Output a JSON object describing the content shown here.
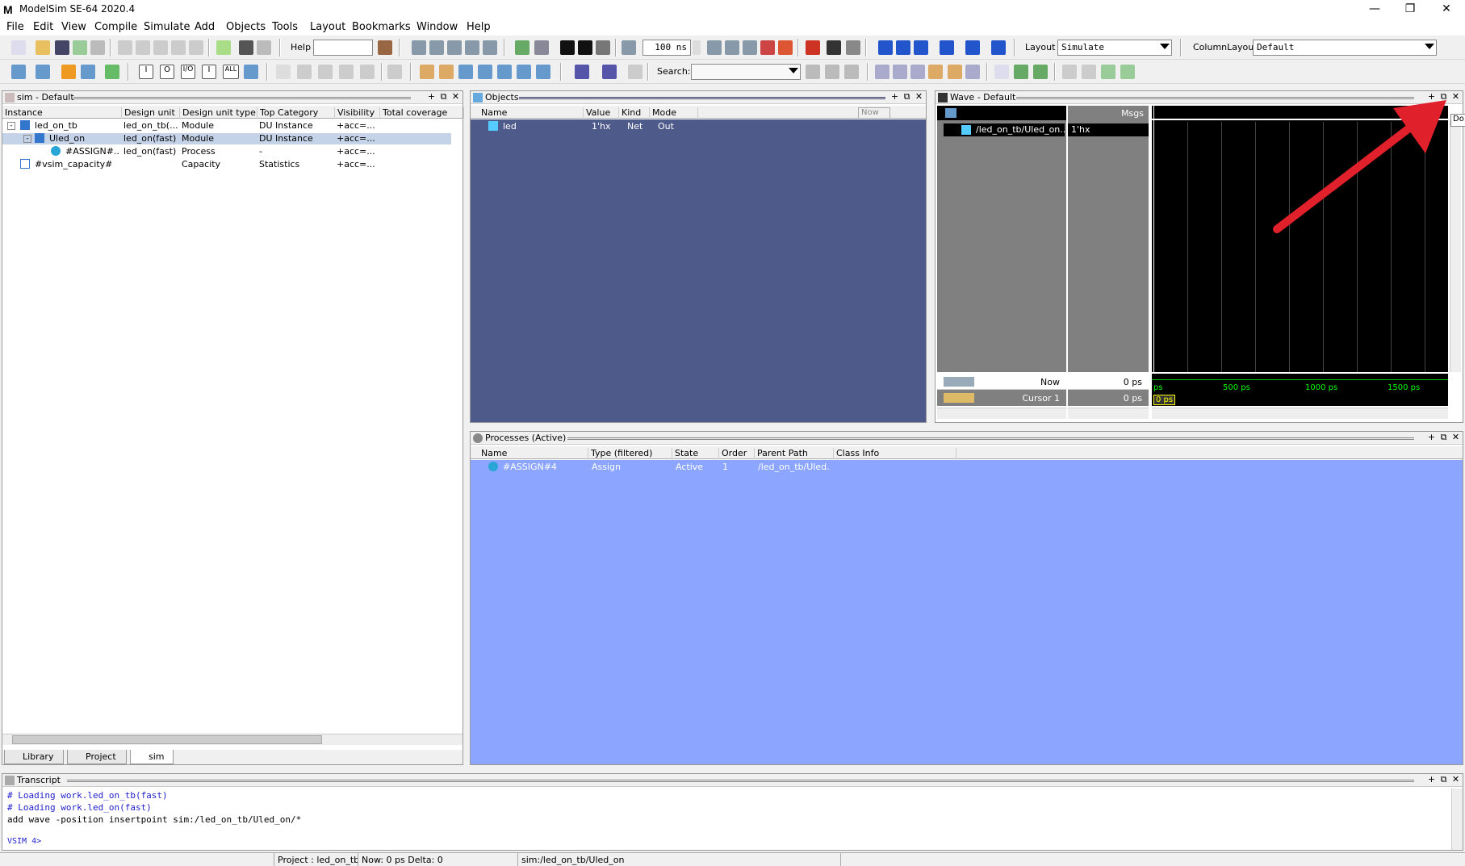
{
  "window": {
    "title": "ModelSim SE-64 2020.4",
    "logo": "M",
    "buttons": [
      "—",
      "❐",
      "✕"
    ]
  },
  "menu": [
    "File",
    "Edit",
    "View",
    "Compile",
    "Simulate",
    "Add",
    "Objects",
    "Tools",
    "Layout",
    "Bookmarks",
    "Window",
    "Help"
  ],
  "toolbar": {
    "help_label": "Help",
    "help_value": "",
    "runtime_value": "100 ns",
    "layout_label": "Layout",
    "layout_value": "Simulate",
    "column_layout_label": "ColumnLayout",
    "column_layout_value": "Default",
    "search_label": "Search:",
    "search_value": "",
    "filter_buttons": [
      "I",
      "O",
      "I/O",
      "I",
      "ALL"
    ]
  },
  "sim_panel": {
    "title": "sim - Default",
    "columns": [
      "Instance",
      "Design unit",
      "Design unit type",
      "Top Category",
      "Visibility",
      "Total coverage"
    ],
    "rows": [
      {
        "expander": "-",
        "instance": "led_on_tb",
        "unit": "led_on_tb(...",
        "type": "Module",
        "category": "DU Instance",
        "visibility": "+acc=..."
      },
      {
        "expander": "-",
        "instance": "Uled_on",
        "unit": "led_on(fast)",
        "type": "Module",
        "category": "DU Instance",
        "visibility": "+acc=..."
      },
      {
        "expander": "",
        "instance": "#ASSIGN#...",
        "unit": "led_on(fast)",
        "type": "Process",
        "category": "-",
        "visibility": "+acc=..."
      },
      {
        "expander": "",
        "instance": "#vsim_capacity#",
        "unit": "",
        "type": "Capacity",
        "category": "Statistics",
        "visibility": "+acc=..."
      }
    ],
    "tabs": [
      "Library",
      "Project",
      "sim"
    ]
  },
  "objects_panel": {
    "title": "Objects",
    "columns": [
      "Name",
      "Value",
      "Kind",
      "Mode"
    ],
    "now_label": "Now",
    "rows": [
      {
        "name": "led",
        "value": "1'hx",
        "kind": "Net",
        "mode": "Out"
      }
    ]
  },
  "wave_panel": {
    "title": "Wave - Default",
    "msgs_label": "Msgs",
    "signal_name": "/led_on_tb/Uled_on...",
    "signal_value": "1'hx",
    "now_label": "Now",
    "now_value": "0 ps",
    "cursor_label": "Cursor 1",
    "cursor_value": "0 ps",
    "cursor_marker": "0 ps",
    "ticks": [
      "ps",
      "500 ps",
      "1000 ps",
      "1500 ps"
    ],
    "tooltip": "Do"
  },
  "processes_panel": {
    "title": "Processes (Active)",
    "columns": [
      "Name",
      "Type (filtered)",
      "State",
      "Order",
      "Parent Path",
      "Class Info"
    ],
    "rows": [
      {
        "name": "#ASSIGN#4",
        "type": "Assign",
        "state": "Active",
        "order": "1",
        "parent": "/led_on_tb/Uled..."
      }
    ]
  },
  "transcript": {
    "title": "Transcript",
    "lines": [
      "# Loading work.led_on_tb(fast)",
      "# Loading work.led_on(fast)",
      "add wave -position insertpoint sim:/led_on_tb/Uled_on/*"
    ],
    "prompt": "VSIM 4>"
  },
  "statusbar": {
    "project": "Project : led_on_tb",
    "now": "Now: 0 ps  Delta: 0",
    "path": "sim:/led_on_tb/Uled_on"
  },
  "colors": {
    "objects_bg": "#4e5a8a",
    "processes_bg": "#8ca6ff",
    "wave_bg": "#000000",
    "wave_names_bg": "#808080",
    "annotation_arrow": "#e0202a"
  },
  "icons": [
    "instance-icon",
    "process-icon",
    "capacity-icon",
    "signal-icon",
    "gear-icon",
    "close-icon",
    "dock-icon",
    "undock-icon"
  ]
}
